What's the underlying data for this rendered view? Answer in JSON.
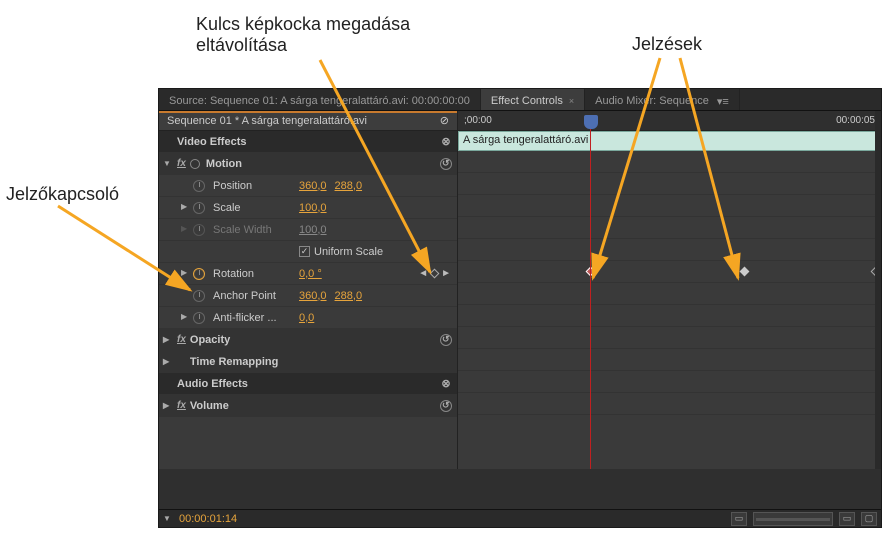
{
  "annotations": {
    "keyframe_label_line1": "Kulcs képkocka megadása",
    "keyframe_label_line2": "eltávolítása",
    "markers_label": "Jelzések",
    "toggle_label": "Jelzőkapcsoló"
  },
  "tabs": {
    "source": "Source: Sequence 01: A sárga tengeralattáró.avi: 00:00:00:00",
    "effect_controls": "Effect Controls",
    "audio_mixer": "Audio Mixer: Sequence"
  },
  "sequence_header": "Sequence 01 * A sárga tengeralattáró.avi",
  "timeline": {
    "start": ";00:00",
    "end": "00:00:05",
    "clip_name": "A sárga tengeralattáró.avi"
  },
  "sections": {
    "video_effects": "Video Effects",
    "audio_effects": "Audio Effects"
  },
  "motion": {
    "label": "Motion",
    "position": {
      "label": "Position",
      "x": "360,0",
      "y": "288,0"
    },
    "scale": {
      "label": "Scale",
      "value": "100,0"
    },
    "scale_width": {
      "label": "Scale Width",
      "value": "100,0"
    },
    "uniform_scale": {
      "label": "Uniform Scale",
      "checked": true
    },
    "rotation": {
      "label": "Rotation",
      "value": "0,0 °"
    },
    "anchor": {
      "label": "Anchor Point",
      "x": "360,0",
      "y": "288,0"
    },
    "anti_flicker": {
      "label": "Anti-flicker ...",
      "value": "0,0"
    }
  },
  "opacity": {
    "label": "Opacity"
  },
  "time_remapping": {
    "label": "Time Remapping"
  },
  "volume": {
    "label": "Volume"
  },
  "footer": {
    "timecode": "00:00:01:14"
  }
}
